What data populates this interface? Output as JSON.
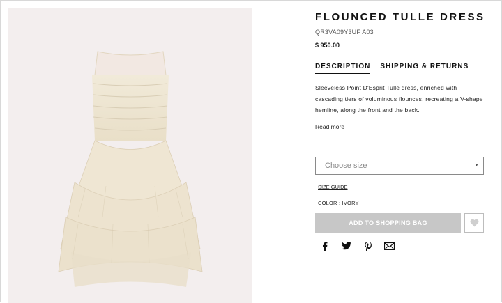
{
  "product": {
    "title": "FLOUNCED TULLE DRESS",
    "sku": "QR3VA09Y3UF A03",
    "price": "$ 950.00",
    "image_alt": "ivory tulle dress"
  },
  "tabs": [
    {
      "label": "DESCRIPTION",
      "active": true
    },
    {
      "label": "SHIPPING & RETURNS",
      "active": false
    }
  ],
  "description": {
    "text": "Sleeveless Point D'Esprit Tulle dress, enriched with cascading tiers of voluminous flounces, recreating a V-shape hemline, along the front and the back.",
    "read_more": "Read more"
  },
  "size_select": {
    "placeholder": "Choose size"
  },
  "size_guide": "SIZE GUIDE",
  "color": {
    "label": "COLOR :",
    "value": "IVORY"
  },
  "bag_button": "ADD TO SHOPPING BAG",
  "share_icons": [
    "facebook-icon",
    "twitter-icon",
    "pinterest-icon",
    "email-icon"
  ],
  "colors": {
    "image_bg": "#f3eeee",
    "dress": "#efe7d6",
    "button_disabled": "#c7c7c7"
  }
}
